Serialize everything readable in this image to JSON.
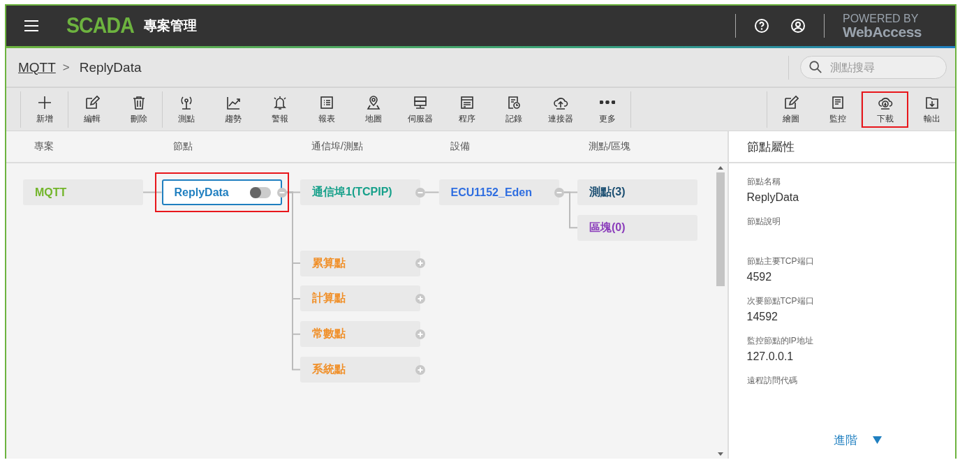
{
  "header": {
    "logo": "SCADA",
    "title": "專案管理",
    "powered_by": "POWERED BY",
    "brand": "WebAccess"
  },
  "breadcrumb": {
    "items": [
      "MQTT",
      "ReplyData"
    ],
    "separator": ">"
  },
  "search": {
    "placeholder": "測點搜尋"
  },
  "toolbar": {
    "left_groups": [
      [
        {
          "label": "新增",
          "kind": "plus",
          "highlighted": false
        }
      ],
      [
        {
          "label": "編輯",
          "kind": "edit",
          "highlighted": false
        },
        {
          "label": "刪除",
          "kind": "trash",
          "highlighted": false
        }
      ],
      [
        {
          "label": "測點",
          "kind": "antenna",
          "highlighted": false
        },
        {
          "label": "趨勢",
          "kind": "trend",
          "highlighted": false
        },
        {
          "label": "警報",
          "kind": "bell",
          "highlighted": false
        },
        {
          "label": "報表",
          "kind": "report",
          "highlighted": false
        },
        {
          "label": "地圖",
          "kind": "map",
          "highlighted": false
        },
        {
          "label": "伺服器",
          "kind": "server",
          "highlighted": false
        },
        {
          "label": "程序",
          "kind": "form",
          "highlighted": false
        },
        {
          "label": "記錄",
          "kind": "log",
          "highlighted": false
        },
        {
          "label": "連接器",
          "kind": "upload",
          "highlighted": false
        },
        {
          "label": "更多",
          "kind": "more",
          "highlighted": false
        }
      ]
    ],
    "right_groups": [
      [
        {
          "label": "繪圖",
          "kind": "edit",
          "highlighted": false
        },
        {
          "label": "監控",
          "kind": "doc",
          "highlighted": false
        }
      ],
      [
        {
          "label": "下載",
          "kind": "download",
          "highlighted": true
        },
        {
          "label": "輸出",
          "kind": "export",
          "highlighted": false
        }
      ]
    ]
  },
  "columns": [
    "專案",
    "節點",
    "通信埠/測點",
    "設備",
    "測點/區塊"
  ],
  "tree": [
    {
      "label": "MQTT",
      "kind": "project",
      "children": [
        {
          "label": "ReplyData",
          "kind": "node",
          "selected": true,
          "highlighted": true,
          "toggle_on": false,
          "expanded": true,
          "children": [
            {
              "label": "通信埠1(TCPIP)",
              "kind": "port",
              "expanded": true,
              "children": [
                {
                  "label": "ECU1152_Eden",
                  "kind": "device",
                  "expanded": true,
                  "children": [
                    {
                      "label": "測點(3)",
                      "kind": "tags"
                    },
                    {
                      "label": "區塊(0)",
                      "kind": "blocks"
                    }
                  ]
                }
              ]
            },
            {
              "label": "累算點",
              "kind": "special",
              "expanded": false
            },
            {
              "label": "計算點",
              "kind": "special",
              "expanded": false
            },
            {
              "label": "常數點",
              "kind": "special",
              "expanded": false
            },
            {
              "label": "系統點",
              "kind": "special",
              "expanded": false
            }
          ]
        }
      ]
    }
  ],
  "properties": {
    "title": "節點屬性",
    "fields": [
      {
        "label": "節點名稱",
        "value": "ReplyData"
      },
      {
        "label": "節點說明"
      },
      {
        "label": "節點主要TCP端口",
        "value": "4592"
      },
      {
        "label": "次要節點TCP端口",
        "value": "14592"
      },
      {
        "label": "監控節點的IP地址",
        "value": "127.0.0.1"
      },
      {
        "label": "遠程訪問代碼"
      }
    ],
    "advanced": {
      "label": "進階",
      "expanded": false
    }
  }
}
